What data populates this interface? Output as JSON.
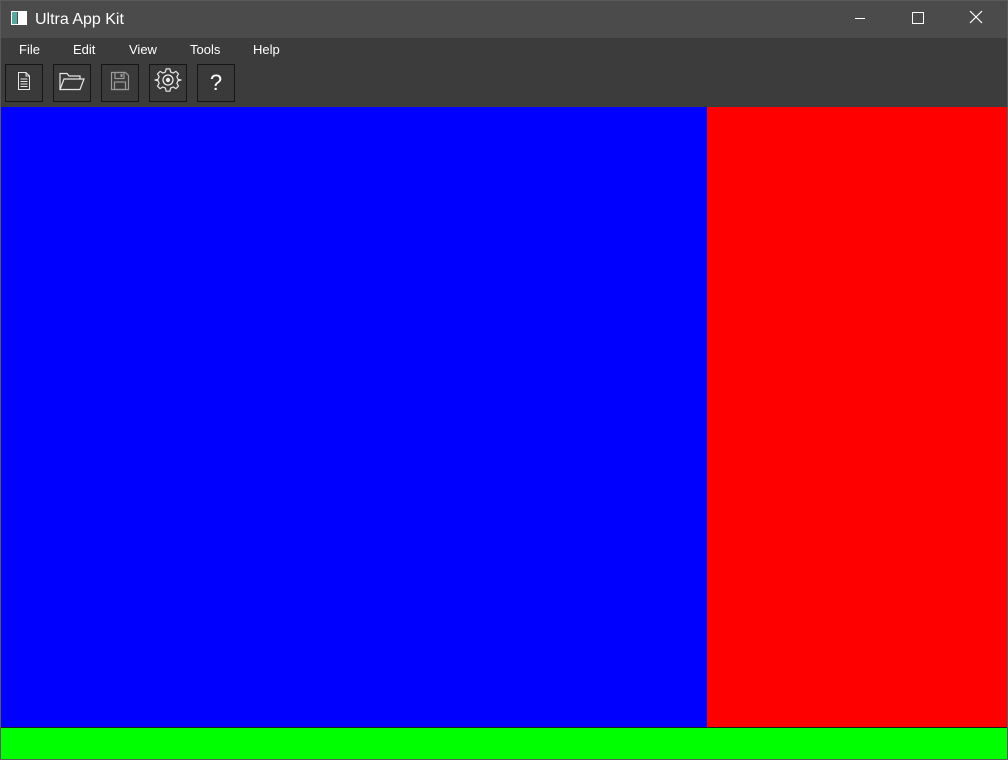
{
  "window": {
    "title": "Ultra App Kit",
    "icons": {
      "app": "app-window-icon",
      "minimize": "minimize-icon",
      "maximize": "maximize-icon",
      "close": "close-icon"
    }
  },
  "menu": {
    "items": [
      {
        "label": "File"
      },
      {
        "label": "Edit"
      },
      {
        "label": "View"
      },
      {
        "label": "Tools"
      },
      {
        "label": "Help"
      }
    ]
  },
  "toolbar": {
    "buttons": [
      {
        "icon": "new-document-icon"
      },
      {
        "icon": "open-folder-icon"
      },
      {
        "icon": "save-disk-icon"
      },
      {
        "icon": "settings-gear-icon"
      },
      {
        "icon": "help-question-icon",
        "glyph": "?"
      }
    ]
  },
  "panels": {
    "left_color": "#0000ff",
    "right_color": "#ff0000",
    "bottom_color": "#00ff00"
  }
}
